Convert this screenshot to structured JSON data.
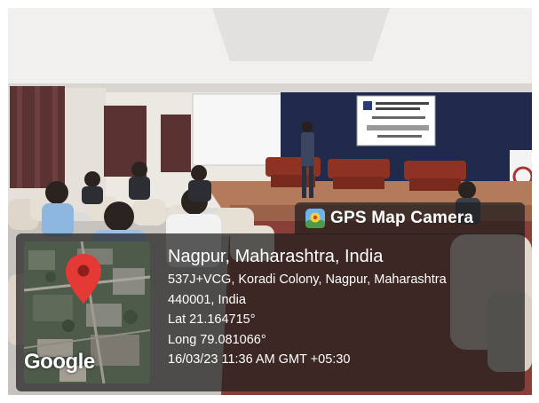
{
  "overlay": {
    "badge_title": "GPS Map Camera",
    "map_attribution": "Google",
    "place": "Nagpur, Maharashtra, India",
    "address_line1": "537J+VCG, Koradi Colony, Nagpur, Maharashtra",
    "address_line2": "440001, India",
    "lat": "Lat 21.164715°",
    "long": "Long 79.081066°",
    "datetime": "16/03/23 11:36 AM GMT +05:30"
  },
  "icons": {
    "camera": "gps-map-camera-icon",
    "pin": "map-pin-icon"
  },
  "colors": {
    "overlay_bg": "#1e1e1e",
    "pin": "#e53935",
    "stage_backdrop": "#1f2a4d",
    "wall": "#ece8e2",
    "curtain": "#5a3232"
  }
}
